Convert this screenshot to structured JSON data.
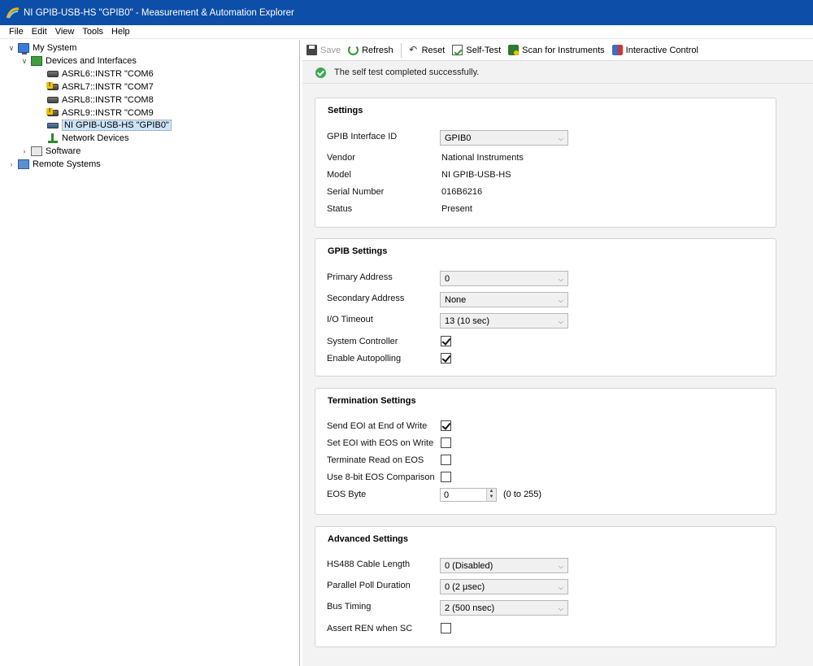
{
  "window": {
    "title": "NI GPIB-USB-HS \"GPIB0\" - Measurement & Automation Explorer"
  },
  "menu": [
    "File",
    "Edit",
    "View",
    "Tools",
    "Help"
  ],
  "tree": {
    "my_system": "My System",
    "devices": "Devices and Interfaces",
    "items": [
      "ASRL6::INSTR \"COM6",
      "ASRL7::INSTR \"COM7",
      "ASRL8::INSTR \"COM8",
      "ASRL9::INSTR \"COM9",
      "NI GPIB-USB-HS \"GPIB0\""
    ],
    "network": "Network Devices",
    "software": "Software",
    "remote": "Remote Systems"
  },
  "toolbar": {
    "save": "Save",
    "refresh": "Refresh",
    "reset": "Reset",
    "self_test": "Self-Test",
    "scan": "Scan for Instruments",
    "interactive": "Interactive Control"
  },
  "banner": "The self test completed successfully.",
  "settings": {
    "title": "Settings",
    "interface_id_label": "GPIB Interface ID",
    "interface_id_value": "GPIB0",
    "vendor_label": "Vendor",
    "vendor_value": "National Instruments",
    "model_label": "Model",
    "model_value": "NI GPIB-USB-HS",
    "serial_label": "Serial Number",
    "serial_value": "016B6216",
    "status_label": "Status",
    "status_value": "Present"
  },
  "gpib_settings": {
    "title": "GPIB Settings",
    "primary_label": "Primary Address",
    "primary_value": "0",
    "secondary_label": "Secondary Address",
    "secondary_value": "None",
    "timeout_label": "I/O Timeout",
    "timeout_value": "13 (10 sec)",
    "sys_ctrl_label": "System Controller",
    "sys_ctrl_checked": true,
    "autopoll_label": "Enable Autopolling",
    "autopoll_checked": true
  },
  "termination": {
    "title": "Termination Settings",
    "send_eoi_label": "Send EOI at End of Write",
    "send_eoi_checked": true,
    "set_eoi_label": "Set EOI with EOS on Write",
    "set_eoi_checked": false,
    "term_read_label": "Terminate Read on EOS",
    "term_read_checked": false,
    "eight_bit_label": "Use 8-bit EOS Comparison",
    "eight_bit_checked": false,
    "eos_byte_label": "EOS Byte",
    "eos_byte_value": "0",
    "eos_byte_range": "(0 to 255)"
  },
  "advanced": {
    "title": "Advanced Settings",
    "cable_label": "HS488 Cable Length",
    "cable_value": "0 (Disabled)",
    "poll_label": "Parallel Poll Duration",
    "poll_value": "0 (2 µsec)",
    "timing_label": "Bus Timing",
    "timing_value": "2 (500 nsec)",
    "ren_label": "Assert REN when SC",
    "ren_checked": false
  }
}
